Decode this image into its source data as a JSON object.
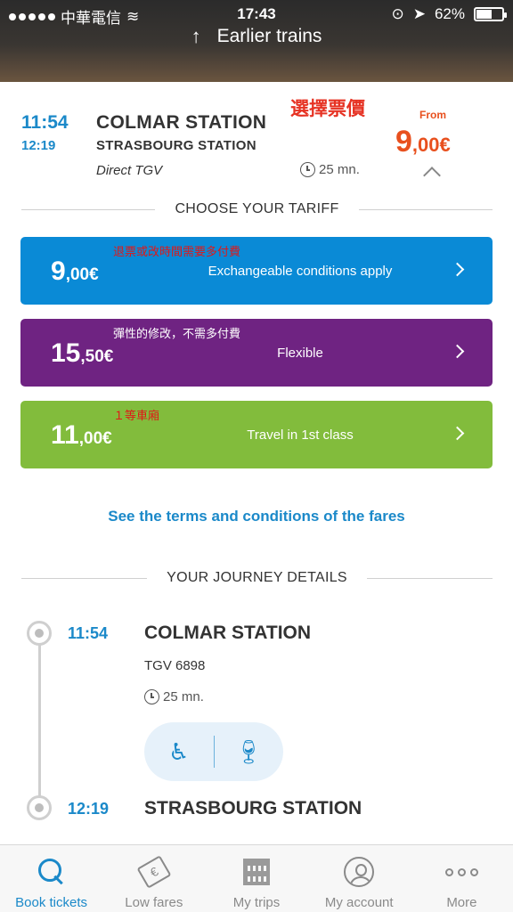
{
  "status_bar": {
    "carrier": "中華電信",
    "time": "17:43",
    "battery": "62%",
    "battery_level": 0.62
  },
  "header": {
    "earlier_label": "Earlier trains",
    "arrow_icon": "arrow-up-icon"
  },
  "summary": {
    "departure_time": "11:54",
    "arrival_time": "12:19",
    "origin": "COLMAR STATION",
    "destination": "STRASBOURG STATION",
    "service": "Direct TGV",
    "duration": "25 mn.",
    "annotation": "選擇票價",
    "from_label": "From",
    "price_int": "9",
    "price_dec": ",00€"
  },
  "tariff_section": {
    "title": "CHOOSE YOUR TARIFF"
  },
  "tariffs": [
    {
      "note": "退票或改時間需要多付費",
      "int": "9",
      "dec": ",00€",
      "desc": "Exchangeable conditions apply",
      "color": "#0a8ad6"
    },
    {
      "note": "彈性的修改，不需多付費",
      "int": "15",
      "dec": ",50€",
      "desc": "Flexible",
      "color": "#6f2382"
    },
    {
      "note": "１等車廂",
      "int": "11",
      "dec": ",00€",
      "desc": "Travel in 1st class",
      "color": "#82bc3c"
    }
  ],
  "terms_link": "See the terms and conditions of the fares",
  "journey_section": {
    "title": "YOUR JOURNEY DETAILS"
  },
  "journey": {
    "dep_time": "11:54",
    "dep_station": "COLMAR STATION",
    "train": "TGV 6898",
    "duration": "25 mn.",
    "amenities": [
      "wheelchair-icon",
      "wine-glass-icon"
    ],
    "arr_time": "12:19",
    "arr_station": "STRASBOURG STATION"
  },
  "tabbar": {
    "items": [
      {
        "label": "Book tickets",
        "icon": "search-icon",
        "active": true
      },
      {
        "label": "Low fares",
        "icon": "price-tag-icon",
        "active": false
      },
      {
        "label": "My trips",
        "icon": "qr-code-icon",
        "active": false
      },
      {
        "label": "My account",
        "icon": "user-icon",
        "active": false
      },
      {
        "label": "More",
        "icon": "more-icon",
        "active": false
      }
    ]
  }
}
